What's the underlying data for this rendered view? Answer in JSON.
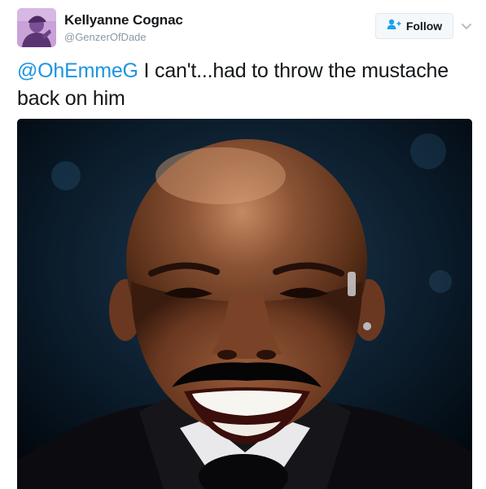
{
  "author": {
    "display_name": "Kellyanne Cognac",
    "handle": "@GenzerOfDade"
  },
  "actions": {
    "follow_label": "Follow",
    "follow_icon": "add-user-icon",
    "menu_icon": "chevron-down-icon"
  },
  "tweet": {
    "mention": "@OhEmmeG",
    "text": " I can't...had to throw the mustache back on him"
  },
  "media": {
    "type": "photo",
    "description_icon": "photo-icon"
  },
  "colors": {
    "link": "#1b95e0",
    "text": "#14171a",
    "muted": "#8899a6",
    "avatar_bg": "#c9a2d8"
  }
}
